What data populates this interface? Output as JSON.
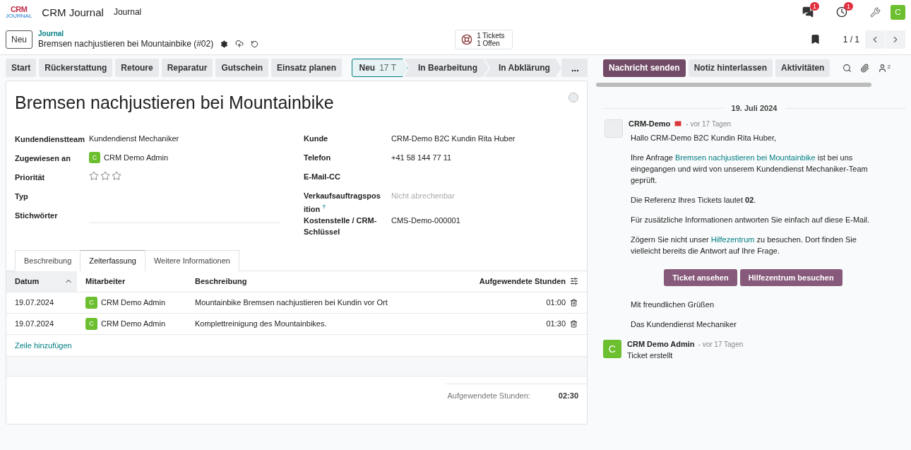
{
  "navbar": {
    "logo_top": "CRM",
    "logo_bottom": "JOURNAL",
    "app_name": "CRM Journal",
    "menu": [
      "Journal"
    ],
    "messages_badge": "1",
    "activities_badge": "1",
    "user_initial": "C"
  },
  "control_panel": {
    "new_button": "Neu",
    "breadcrumb": "Journal",
    "record_title": "Bremsen nachjustieren bei Mountainbike (#02)",
    "tickets_count": "1 Tickets",
    "tickets_open": "1 Offen",
    "pager": "1 / 1"
  },
  "action_buttons": [
    "Start",
    "Rückerstattung",
    "Retoure",
    "Reparatur",
    "Gutschein",
    "Einsatz planen"
  ],
  "stages": [
    {
      "label": "Neu",
      "count": "17 T",
      "selected": true
    },
    {
      "label": "In Bearbeitung",
      "selected": false
    },
    {
      "label": "In Abklärung",
      "selected": false
    }
  ],
  "stages_more": "...",
  "chatter_buttons": [
    {
      "label": "Nachricht senden",
      "selected": true
    },
    {
      "label": "Notiz hinterlassen",
      "selected": false
    },
    {
      "label": "Aktivitäten",
      "selected": false
    }
  ],
  "followers_count": "2",
  "form": {
    "title": "Bremsen nachjustieren bei Mountainbike",
    "left_fields": [
      {
        "label": "Kundendienstteam",
        "kind": "text",
        "value": "Kundendienst Mechaniker"
      },
      {
        "label": "Zugewiesen an",
        "kind": "user",
        "initial": "C",
        "value": "CRM Demo Admin"
      },
      {
        "label": "Priorität",
        "kind": "stars",
        "stars": 0
      },
      {
        "label": "Typ",
        "kind": "empty"
      },
      {
        "label": "Stichwörter",
        "kind": "tags"
      }
    ],
    "right_fields": [
      {
        "label": "Kunde",
        "kind": "text",
        "value": "CRM-Demo B2C Kundin Rita Huber"
      },
      {
        "label": "Telefon",
        "kind": "text",
        "value": "+41 58 144 77 11"
      },
      {
        "label": "E-Mail-CC",
        "kind": "empty"
      },
      {
        "label": "Verkaufsauftragsposition",
        "help": "?",
        "kind": "placeholder",
        "placeholder": "Nicht abrechenbar"
      },
      {
        "label": "Kostenstelle / CRM-Schlüssel",
        "kind": "text",
        "value": "CMS-Demo-000001"
      }
    ]
  },
  "tabs": [
    {
      "label": "Beschreibung",
      "selected": false
    },
    {
      "label": "Zeiterfassung",
      "selected": true
    },
    {
      "label": "Weitere Informationen",
      "selected": false
    }
  ],
  "table": {
    "columns": [
      {
        "label": "Datum",
        "sorted": true
      },
      {
        "label": "Mitarbeiter",
        "sorted": false
      },
      {
        "label": "Beschreibung",
        "sorted": false
      },
      {
        "label": "Aufgewendete Stunden",
        "sorted": false
      }
    ],
    "rows": [
      {
        "date": "19.07.2024",
        "initial": "C",
        "employee": "CRM Demo Admin",
        "description": "Mountainbike Bremsen nachjustieren bei Kundin vor Ort",
        "hours": "01:00"
      },
      {
        "date": "19.07.2024",
        "initial": "C",
        "employee": "CRM Demo Admin",
        "description": "Komplettreinigung des Mountainbikes.",
        "hours": "01:30"
      }
    ],
    "add_line": "Zeile hinzufügen",
    "total_label": "Aufgewendete Stunden:",
    "total_value": "02:30"
  },
  "chatter": {
    "date_separator": "19. Juli 2024",
    "messages": [
      {
        "kind": "email",
        "author": "CRM-Demo",
        "time": "- vor 17 Tagen",
        "paragraphs": [
          [
            {
              "kind": "text",
              "text": "Hallo CRM-Demo B2C Kundin Rita Huber,"
            }
          ],
          [
            {
              "kind": "text",
              "text": "Ihre Anfrage "
            },
            {
              "kind": "link",
              "text": "Bremsen nachjustieren bei Mountainbike"
            },
            {
              "kind": "text",
              "text": " ist bei uns eingegangen und wird von unserem Kundendienst Mechaniker-Team geprüft."
            }
          ],
          [
            {
              "kind": "text",
              "text": "Die Referenz Ihres Tickets lautet **02**."
            }
          ],
          [
            {
              "kind": "text",
              "text": "Für zusätzliche Informationen antworten Sie einfach auf diese E-Mail."
            }
          ],
          [
            {
              "kind": "text",
              "text": "Zögern Sie nicht unser "
            },
            {
              "kind": "link",
              "text": "Hilfezentrum"
            },
            {
              "kind": "text",
              "text": " zu besuchen. Dort finden Sie vielleicht bereits die Antwort auf Ihre Frage."
            }
          ]
        ],
        "buttons": [
          "Ticket ansehen",
          "Hilfezentrum besuchen"
        ],
        "closing": [
          "Mit freundlichen Grüßen",
          "Das Kundendienst Mechaniker"
        ]
      },
      {
        "kind": "note",
        "author": "CRM Demo Admin",
        "initial": "C",
        "time": "- vor 17 Tagen",
        "body": "Ticket erstellt"
      }
    ]
  }
}
